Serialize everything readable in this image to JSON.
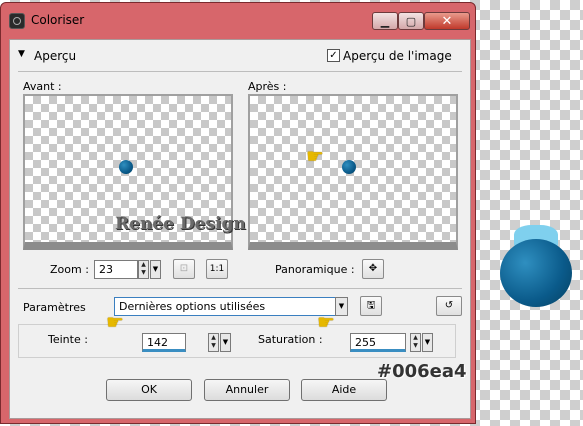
{
  "window": {
    "title": "Coloriser",
    "minimize_icon": "minimize-icon",
    "maximize_icon": "maximize-icon",
    "close_icon": "close-icon"
  },
  "preview_section": {
    "header": "Aperçu",
    "image_preview_label": "Aperçu de l'image",
    "image_preview_checked": true,
    "before_label": "Avant :",
    "after_label": "Après :",
    "watermark_text": "Renée Design",
    "zoom_label": "Zoom :",
    "zoom_value": "23",
    "zoom_fit_label": "1:1",
    "pan_label": "Panoramique :"
  },
  "parameters": {
    "label": "Paramètres",
    "preset_value": "Dernières options utilisées",
    "hue_label": "Teinte :",
    "hue_value": "142",
    "saturation_label": "Saturation :",
    "saturation_value": "255",
    "annotation": "#006ea4"
  },
  "buttons": {
    "ok": "OK",
    "cancel": "Annuler",
    "help": "Aide"
  },
  "colors": {
    "ball": "#006ea4",
    "titlebar": "#d7666b"
  }
}
